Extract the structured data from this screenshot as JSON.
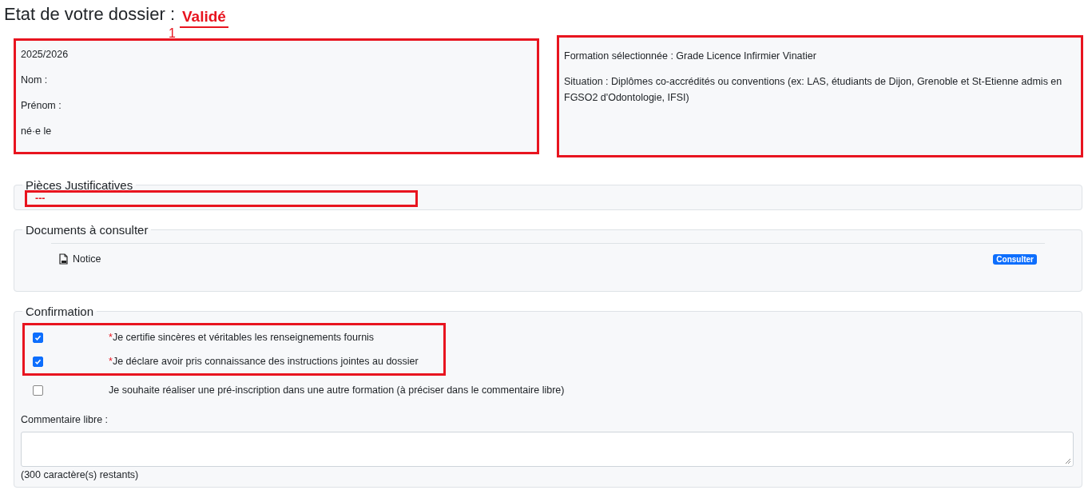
{
  "header": {
    "title": "Etat de votre dossier :",
    "status": "Validé",
    "annotation_number": "1"
  },
  "identity": {
    "highlighted": true,
    "lines": [
      "2025/2026",
      "Nom :",
      "Prénom :",
      "né·e le"
    ]
  },
  "formation": {
    "highlighted": true,
    "lines": [
      "Formation sélectionnée : Grade Licence Infirmier Vinatier",
      "Situation : Diplômes co-accrédités ou conventions (ex: LAS, étudiants de Dijon, Grenoble et St-Etienne admis en FGSO2 d'Odontologie, IFSI)"
    ]
  },
  "pieces": {
    "legend": "Pièces Justificatives",
    "highlighted": true,
    "value": "---"
  },
  "documents": {
    "legend": "Documents à consulter",
    "items": [
      {
        "name": "Notice",
        "button": "Consulter"
      }
    ]
  },
  "confirmation": {
    "legend": "Confirmation",
    "checks": [
      {
        "label": "Je certifie sincères et véritables les renseignements fournis",
        "required_mark": "*",
        "checked": true,
        "highlighted": true
      },
      {
        "label": "Je déclare avoir pris connaissance des instructions jointes au dossier",
        "required_mark": "*",
        "checked": true,
        "highlighted": true
      },
      {
        "label": "Je souhaite réaliser une pré-inscription dans une autre formation (à préciser dans le commentaire libre)",
        "checked": false,
        "highlighted": false
      }
    ],
    "comment_label": "Commentaire libre :",
    "counter": "(300 caractère(s) restants)"
  }
}
